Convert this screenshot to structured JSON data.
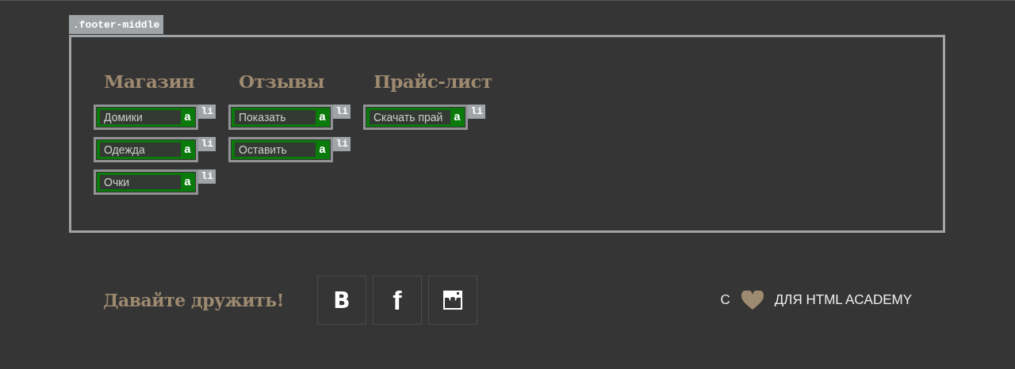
{
  "section_label": ".footer-middle",
  "columns": [
    {
      "heading": "Магазин",
      "items": [
        {
          "text": "Домики",
          "tag_a": "a",
          "tag_li": "li"
        },
        {
          "text": "Одежда",
          "tag_a": "a",
          "tag_li": "li"
        },
        {
          "text": "Очки",
          "tag_a": "a",
          "tag_li": "li"
        }
      ]
    },
    {
      "heading": "Отзывы",
      "items": [
        {
          "text": "Показать",
          "tag_a": "a",
          "tag_li": "li"
        },
        {
          "text": "Оставить",
          "tag_a": "a",
          "tag_li": "li"
        }
      ]
    },
    {
      "heading": "Прайс-лист",
      "items": [
        {
          "text": "Скачать прай",
          "tag_a": "a",
          "tag_li": "li"
        }
      ]
    }
  ],
  "social": {
    "title": "Давайте дружить!",
    "links": [
      {
        "kind": "vk",
        "label": "В"
      },
      {
        "kind": "facebook",
        "label": "f"
      },
      {
        "kind": "instagram"
      }
    ]
  },
  "credit": {
    "prefix": "С",
    "suffix": "ДЛЯ HTML ACADEMY"
  }
}
